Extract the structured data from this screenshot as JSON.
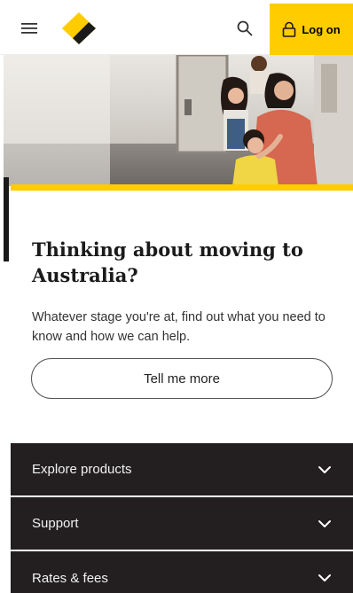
{
  "header": {
    "menu_icon": "hamburger-menu-icon",
    "logo_icon": "diamond-logo-icon",
    "search_icon": "search-icon",
    "login_label": "Log on",
    "lock_icon": "lock-icon",
    "accent_color": "#ffcc00"
  },
  "hero": {
    "image": "family-photo"
  },
  "card": {
    "title": "Thinking about moving to Australia?",
    "body": "Whatever stage you're at, find out what you need to know and how we can help.",
    "cta_label": "Tell me more"
  },
  "accordion": {
    "items": [
      {
        "label": "Explore products"
      },
      {
        "label": "Support"
      },
      {
        "label": "Rates & fees"
      }
    ],
    "background": "#231f20"
  }
}
